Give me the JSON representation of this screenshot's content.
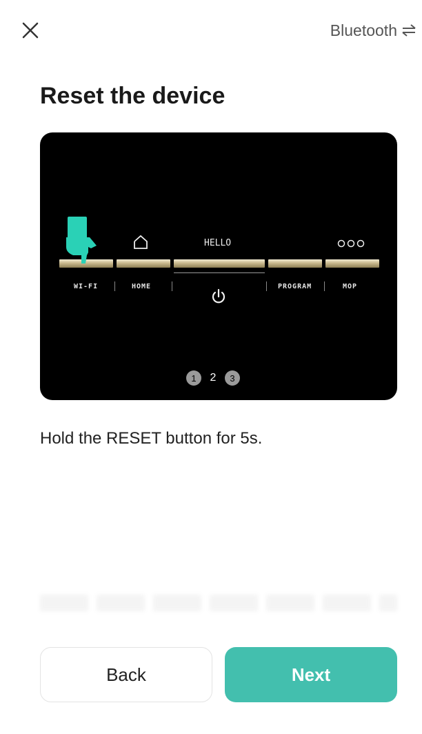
{
  "header": {
    "connection_label": "Bluetooth",
    "close_icon": "close-icon",
    "switch_icon": "switch-arrows-icon"
  },
  "page_title": "Reset the device",
  "device_panel": {
    "display_text": "HELLO",
    "segments": [
      "WI-FI",
      "HOME",
      "PROGRAM",
      "MOP"
    ],
    "steps": [
      "1",
      "2",
      "3"
    ],
    "current_step": "2",
    "hand_color": "#2ad1b6"
  },
  "instruction": "Hold the RESET button for 5s.",
  "buttons": {
    "back": "Back",
    "next": "Next"
  },
  "colors": {
    "accent": "#43bfae",
    "panel_background": "#000000"
  }
}
